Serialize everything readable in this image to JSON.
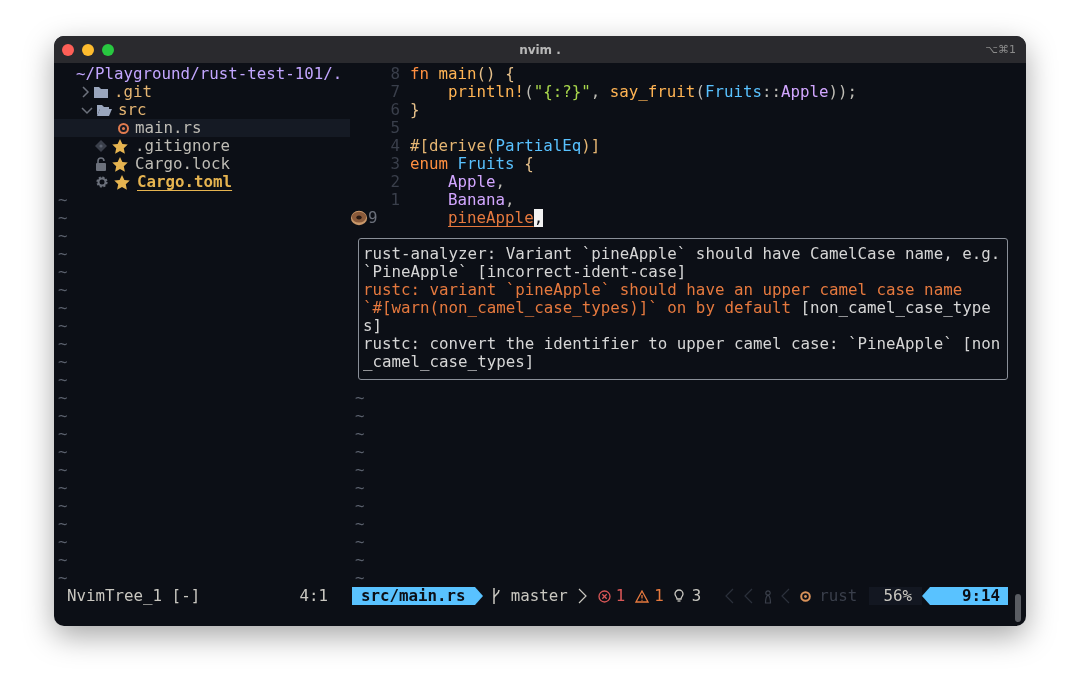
{
  "window": {
    "title": "nvim .",
    "shortcut": "⌥⌘1"
  },
  "file_tree": {
    "root": "~/Playground/rust-test-101/.",
    "filler": "~",
    "items": [
      {
        "kind": "folder",
        "name": ".git",
        "expanded": false,
        "selected": false,
        "marked": false
      },
      {
        "kind": "folder",
        "name": "src",
        "expanded": true,
        "selected": false,
        "marked": false,
        "children": [
          {
            "kind": "rust_file",
            "name": "main.rs",
            "selected": true,
            "marked": false
          }
        ]
      },
      {
        "kind": "ignore_file",
        "name": ".gitignore",
        "selected": false,
        "marked": true
      },
      {
        "kind": "lock_file",
        "name": "Cargo.lock",
        "selected": false,
        "marked": true
      },
      {
        "kind": "manifest_file",
        "name": "Cargo.toml",
        "selected": false,
        "marked": true
      }
    ]
  },
  "editor": {
    "filler": "~",
    "lines": [
      {
        "number": "8",
        "current": false,
        "flagged": false,
        "tokens": [
          {
            "kind": "keyword",
            "text": "fn"
          },
          {
            "kind": "function",
            "text": " main"
          },
          {
            "kind": "bracket",
            "text": "() {"
          }
        ]
      },
      {
        "number": "7",
        "current": false,
        "flagged": false,
        "tokens": [
          {
            "kind": "function",
            "text": "    println!"
          },
          {
            "kind": "plain",
            "text": "("
          },
          {
            "kind": "string",
            "text": "\"{:?}\""
          },
          {
            "kind": "plain",
            "text": ", "
          },
          {
            "kind": "function",
            "text": "say_fruit"
          },
          {
            "kind": "plain",
            "text": "("
          },
          {
            "kind": "type",
            "text": "Fruits"
          },
          {
            "kind": "plain",
            "text": "::"
          },
          {
            "kind": "variant",
            "text": "Apple"
          },
          {
            "kind": "plain",
            "text": "));"
          }
        ]
      },
      {
        "number": "6",
        "current": false,
        "flagged": false,
        "tokens": [
          {
            "kind": "bracket",
            "text": "}"
          }
        ]
      },
      {
        "number": "5",
        "current": false,
        "flagged": false
      },
      {
        "number": "4",
        "current": false,
        "flagged": false,
        "tokens": [
          {
            "kind": "attribute",
            "text": "#[derive("
          },
          {
            "kind": "type",
            "text": "PartialEq"
          },
          {
            "kind": "attribute",
            "text": ")]"
          }
        ]
      },
      {
        "number": "3",
        "current": false,
        "flagged": false,
        "tokens": [
          {
            "kind": "keyword",
            "text": "enum"
          },
          {
            "kind": "type",
            "text": " Fruits"
          },
          {
            "kind": "bracket",
            "text": " {"
          }
        ]
      },
      {
        "number": "2",
        "current": false,
        "flagged": false,
        "tokens": [
          {
            "kind": "variant",
            "text": "    Apple"
          },
          {
            "kind": "plain",
            "text": ","
          }
        ]
      },
      {
        "number": "1",
        "current": false,
        "flagged": false,
        "tokens": [
          {
            "kind": "variant",
            "text": "    Banana"
          },
          {
            "kind": "plain",
            "text": ","
          }
        ]
      },
      {
        "number": "9",
        "current": true,
        "flagged": true,
        "tokens": [
          {
            "kind": "diagnostic",
            "text": "    pineApple"
          },
          {
            "kind": "cursor",
            "text": ","
          }
        ]
      }
    ]
  },
  "diagnostics": {
    "messages": [
      {
        "kind": "info",
        "text": "rust-analyzer: Variant `pineApple` should have CamelCase name, e.g. `PineApple`",
        "code": "[incorrect-ident-case]"
      },
      {
        "kind": "warning",
        "text": "rustc: variant `pineApple` should have an upper camel case name\n`#[warn(non_camel_case_types)]` on by default",
        "code": "[non_camel_case_types]"
      },
      {
        "kind": "info",
        "text": "rustc: convert the identifier to upper camel case: `PineApple`",
        "code": "[non_camel_case_types]"
      }
    ]
  },
  "status_line": {
    "tree_name": "NvimTree_1 [-]",
    "tree_position": "4:1",
    "file": "src/main.rs",
    "branch": "master",
    "errors": "1",
    "warnings": "1",
    "hints": "3",
    "filetype": "rust",
    "progress": "56%",
    "location": "9:14"
  }
}
